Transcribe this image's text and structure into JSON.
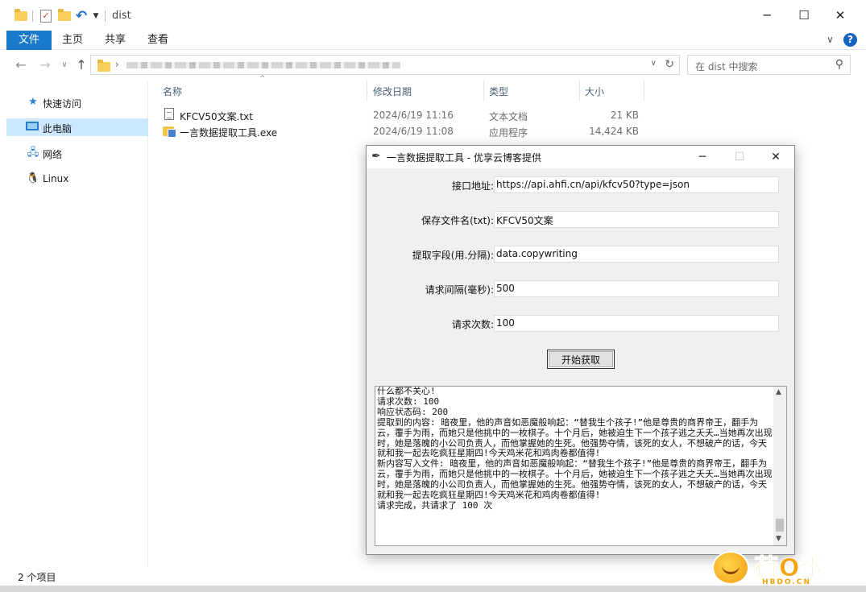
{
  "explorer": {
    "window_title": "dist",
    "ribbon_tabs": [
      "文件",
      "主页",
      "共享",
      "查看"
    ],
    "search_placeholder": "在 dist 中搜索",
    "nav_items": [
      "快速访问",
      "此电脑",
      "网络",
      "Linux"
    ],
    "columns": [
      "名称",
      "修改日期",
      "类型",
      "大小"
    ],
    "files": [
      {
        "name": "KFCV50文案.txt",
        "date": "2024/6/19 11:16",
        "type": "文本文档",
        "size": "21 KB",
        "icon": "text-file-icon"
      },
      {
        "name": "一言数据提取工具.exe",
        "date": "2024/6/19 11:08",
        "type": "应用程序",
        "size": "14,424 KB",
        "icon": "exe-icon"
      }
    ],
    "status": "2 个项目"
  },
  "dialog": {
    "title": "一言数据提取工具 - 优享云博客提供",
    "fields": [
      {
        "label": "接口地址:",
        "value": "https://api.ahfi.cn/api/kfcv50?type=json"
      },
      {
        "label": "保存文件名(txt):",
        "value": "KFCV50文案"
      },
      {
        "label": "提取字段(用.分隔):",
        "value": "data.copywriting"
      },
      {
        "label": "请求间隔(毫秒):",
        "value": "500"
      },
      {
        "label": "请求次数:",
        "value": "100"
      }
    ],
    "start_button": "开始获取",
    "log_lines": [
      "什么都不关心!",
      "请求次数: 100",
      "响应状态码: 200",
      "提取到的内容: 暗夜里，他的声音如恶魔般响起：“替我生个孩子!”他是尊贵的商界帝王，翻手为云，覆手为雨，而她只是他挑中的一枚棋子。十个月后，她被迫生下一个孩子逃之夭夭…当她再次出现时，她是落魄的小公司负责人，而他掌握她的生死。他强势夺情，该死的女人，不想破产的话，今天就和我一起去吃疯狂星期四!今天鸡米花和鸡肉卷都值得!",
      "新内容写入文件: 暗夜里，他的声音如恶魔般响起：“替我生个孩子!”他是尊贵的商界帝王，翻手为云，覆手为雨，而她只是他挑中的一枚棋子。十个月后，她被迫生下一个孩子逃之夭夭…当她再次出现时，她是落魄的小公司负责人，而他掌握她的生死。他强势夺情，该死的女人，不想破产的话，今天就和我一起去吃疯狂星期四!今天鸡米花和鸡肉卷都值得!",
      "请求完成，共请求了 100 次"
    ]
  },
  "watermark": {
    "text": "荷O蛋",
    "sub": "HBDO.CN"
  }
}
